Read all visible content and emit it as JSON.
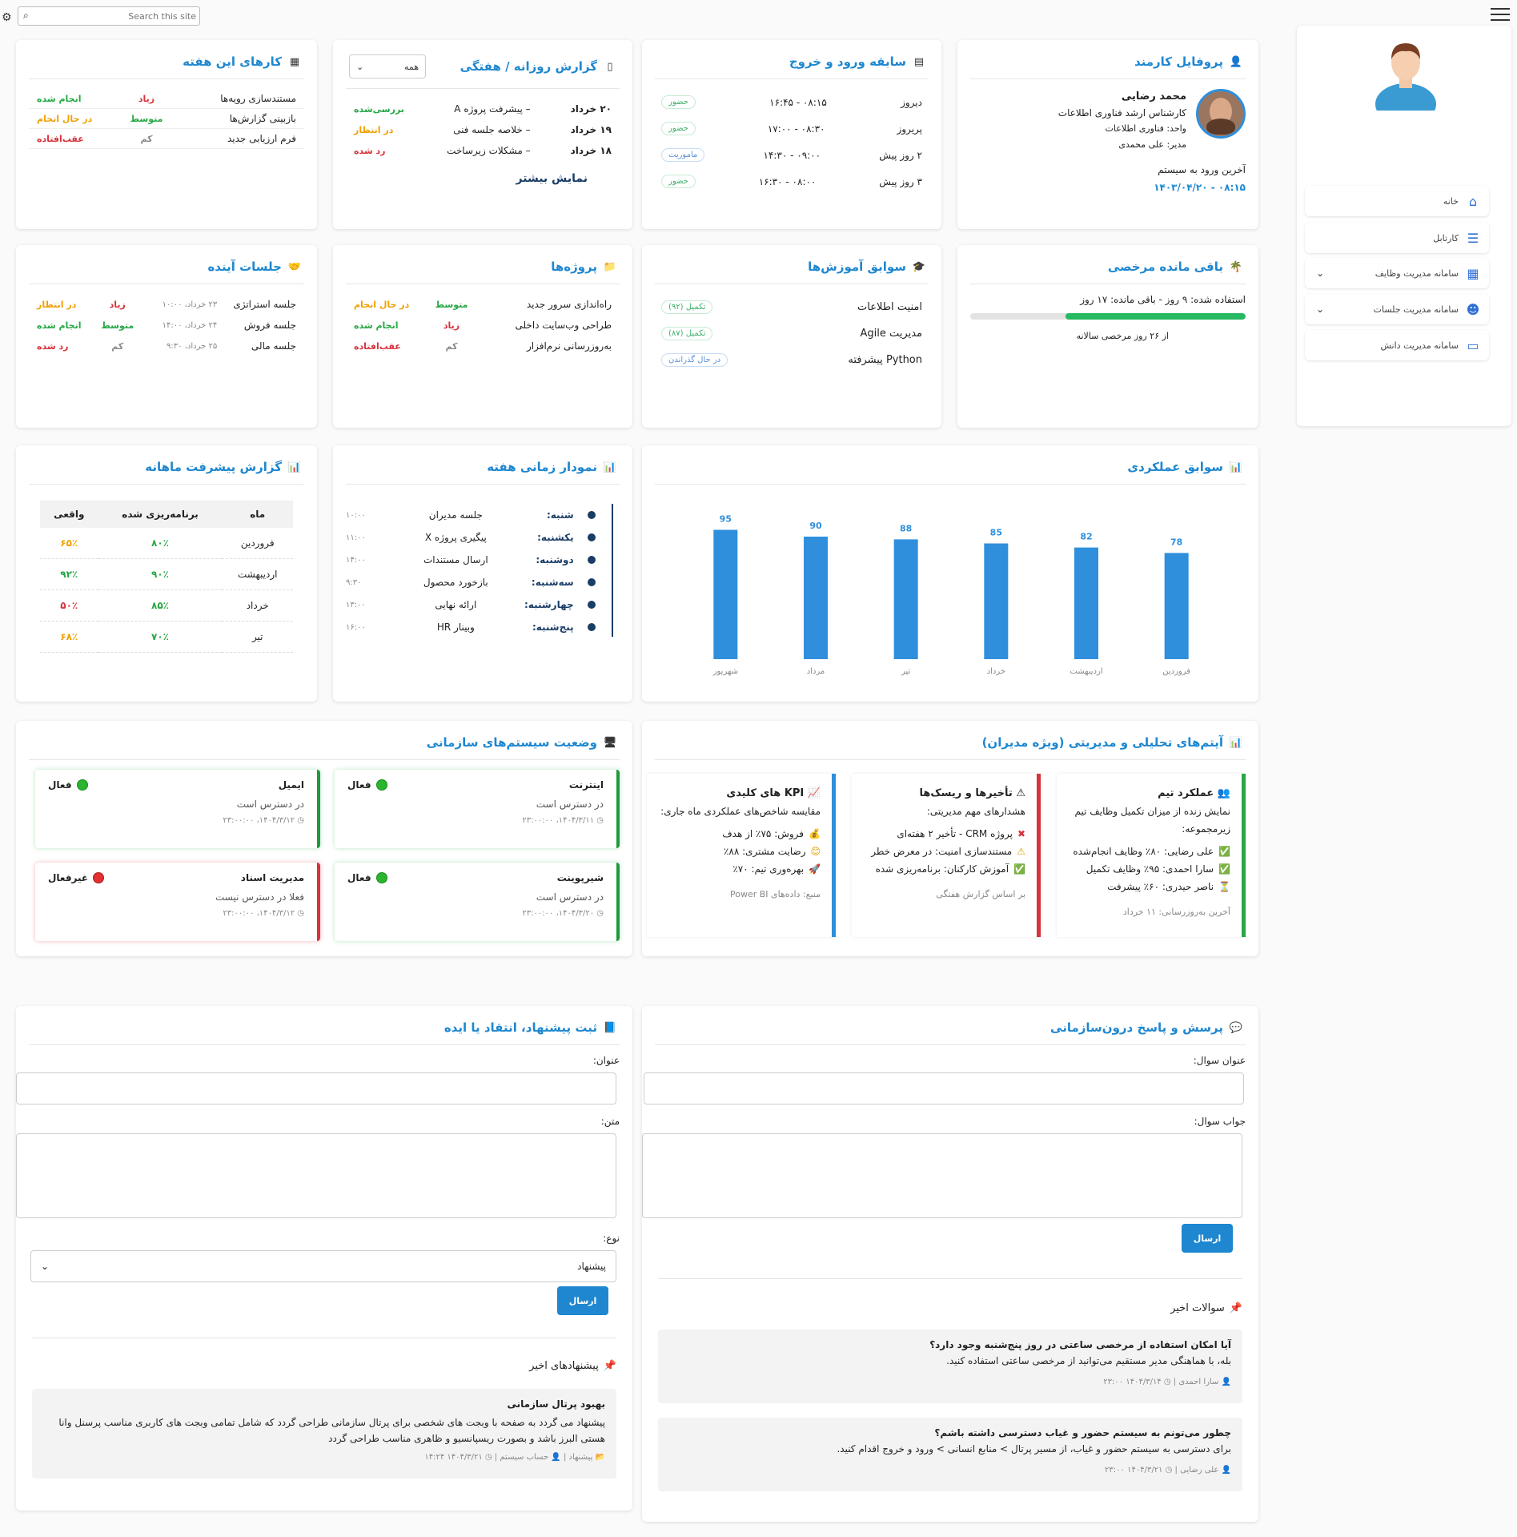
{
  "topbar": {
    "search_placeholder": "Search this site"
  },
  "sidebar": {
    "items": [
      {
        "label": "خانه",
        "icon": "home-icon"
      },
      {
        "label": "کارتابل",
        "icon": "inbox-icon"
      },
      {
        "label": "سامانه مدیریت وظایف",
        "icon": "tasks-icon"
      },
      {
        "label": "سامانه مدیریت جلسات",
        "icon": "users-icon"
      },
      {
        "label": "سامانه مدیریت دانش",
        "icon": "knowledge-icon"
      }
    ]
  },
  "profile": {
    "title": "پروفایل کارمند",
    "name": "محمد رضایی",
    "role": "کارشناس ارشد فناوری اطلاعات",
    "unit": "واحد: فناوری اطلاعات",
    "manager": "مدیر: علی محمدی",
    "last_login_label": "آخرین ورود به سیستم",
    "last_login_value": "۰۸:۱۵ - ۱۴۰۳/۰۴/۲۰"
  },
  "attendance": {
    "title": "سابقه ورود و خروج",
    "rows": [
      {
        "day": "دیروز",
        "time": "۰۸:۱۵ - ۱۶:۴۵",
        "status": "حضور",
        "kind": "green"
      },
      {
        "day": "پریروز",
        "time": "۰۸:۳۰ - ۱۷:۰۰",
        "status": "حضور",
        "kind": "green"
      },
      {
        "day": "۲ روز پیش",
        "time": "۰۹:۰۰ - ۱۴:۳۰",
        "status": "ماموریت",
        "kind": "blue"
      },
      {
        "day": "۳ روز پیش",
        "time": "۰۸:۰۰ - ۱۶:۳۰",
        "status": "حضور",
        "kind": "green"
      }
    ]
  },
  "daily_report": {
    "title": "گزارش روزانه / هفتگی",
    "filter": "همه",
    "rows": [
      {
        "date": "۲۰ خرداد",
        "text": "– پیشرفت پروژه A",
        "status": "بررسی‌شده",
        "kind": "green"
      },
      {
        "date": "۱۹ خرداد",
        "text": "– خلاصه جلسه فنی",
        "status": "در انتظار",
        "kind": "orange"
      },
      {
        "date": "۱۸ خرداد",
        "text": "– مشکلات زیرساخت",
        "status": "رد شده",
        "kind": "red"
      }
    ],
    "more": "نمایش بیشتر"
  },
  "week_tasks": {
    "title": "کارهای این هفته",
    "rows": [
      {
        "task": "مستندسازی رویه‌ها",
        "priority": "زیاد",
        "pkind": "red",
        "status": "انجام شده",
        "skind": "green"
      },
      {
        "task": "بازبینی گزارش‌ها",
        "priority": "متوسط",
        "pkind": "green",
        "status": "در حال انجام",
        "skind": "orange"
      },
      {
        "task": "فرم ارزیابی جدید",
        "priority": "کم",
        "pkind": "muted",
        "status": "عقب‌افتاده",
        "skind": "red"
      }
    ]
  },
  "leave": {
    "title": "باقی مانده مرخصی",
    "text": "استفاده شده: ۹ روز - باقی مانده: ۱۷ روز",
    "used_fraction": 0.654,
    "annual": "از ۲۶ روز مرخصی سالانه"
  },
  "training": {
    "title": "سوابق آموزش‌ها",
    "rows": [
      {
        "course": "امنیت اطلاعات",
        "status": "تکمیل (۹۲)",
        "kind": "green"
      },
      {
        "course": "مدیریت Agile",
        "status": "تکمیل (۸۷)",
        "kind": "green"
      },
      {
        "course": "Python پیشرفته",
        "status": "در حال گذراندن",
        "kind": "blue"
      }
    ]
  },
  "projects": {
    "title": "پروژه‌ها",
    "rows": [
      {
        "name": "راه‌اندازی سرور جدید",
        "priority": "متوسط",
        "pkind": "green",
        "status": "در حال انجام",
        "skind": "orange"
      },
      {
        "name": "طراحی وب‌سایت داخلی",
        "priority": "زیاد",
        "pkind": "red",
        "status": "انجام شده",
        "skind": "green"
      },
      {
        "name": "به‌روزرسانی نرم‌افزار",
        "priority": "کم",
        "pkind": "muted",
        "status": "عقب‌افتاده",
        "skind": "red"
      }
    ]
  },
  "meetings": {
    "title": "جلسات آینده",
    "rows": [
      {
        "name": "جلسه استراتژی",
        "when": "۲۳ خرداد، ۱۰:۰۰",
        "priority": "زیاد",
        "pkind": "red",
        "status": "در انتظار",
        "skind": "orange"
      },
      {
        "name": "جلسه فروش",
        "when": "۲۴ خرداد، ۱۴:۰۰",
        "priority": "متوسط",
        "pkind": "green",
        "status": "انجام شده",
        "skind": "green"
      },
      {
        "name": "جلسه مالی",
        "when": "۲۵ خرداد، ۹:۳۰",
        "priority": "کم",
        "pkind": "muted",
        "status": "رد شده",
        "skind": "red"
      }
    ]
  },
  "performance": {
    "title": "سوابق عملکردی"
  },
  "chart_data": {
    "type": "bar",
    "categories": [
      "فروردین",
      "اردیبهشت",
      "خرداد",
      "تیر",
      "مرداد",
      "شهریور"
    ],
    "values": [
      78,
      82,
      85,
      88,
      90,
      95
    ],
    "title": "",
    "xlabel": "",
    "ylabel": "",
    "color": "#2f8fdd",
    "ylim": [
      0,
      100
    ]
  },
  "timeline": {
    "title": "نمودار زمانی هفته",
    "rows": [
      {
        "day": "شنبه:",
        "event": "جلسه مدیران",
        "time": "۱۰:۰۰"
      },
      {
        "day": "یکشنبه:",
        "event": "پیگیری پروژه X",
        "time": "۱۱:۰۰"
      },
      {
        "day": "دوشنبه:",
        "event": "ارسال مستندات",
        "time": "۱۴:۰۰"
      },
      {
        "day": "سه‌شنبه:",
        "event": "بازخورد محصول",
        "time": "۹:۳۰"
      },
      {
        "day": "چهارشنبه:",
        "event": "ارائه نهایی",
        "time": "۱۳:۰۰"
      },
      {
        "day": "پنج‌شنبه:",
        "event": "وبینار HR",
        "time": "۱۶:۰۰"
      }
    ]
  },
  "monthly": {
    "title": "گزارش پیشرفت ماهانه",
    "headers": [
      "ماه",
      "برنامه‌ریزی شده",
      "واقعی"
    ],
    "rows": [
      {
        "month": "فروردین",
        "plan": "۸۰٪",
        "actual": "۶۵٪",
        "akind": "orange"
      },
      {
        "month": "اردیبهشت",
        "plan": "۹۰٪",
        "actual": "۹۲٪",
        "akind": "green"
      },
      {
        "month": "خرداد",
        "plan": "۸۵٪",
        "actual": "۵۰٪",
        "akind": "red"
      },
      {
        "month": "تیر",
        "plan": "۷۰٪",
        "actual": "۶۸٪",
        "akind": "orange"
      }
    ]
  },
  "analytics": {
    "title": "آیتم‌های تحلیلی و مدیریتی (ویژه مدیران)",
    "team": {
      "title": "عملکرد تیم",
      "desc": "نمایش زنده از میزان تکمیل وظایف تیم زیرمجموعه:",
      "items": [
        "علی رضایی: ۸۰٪ وظایف انجام‌شده",
        "سارا احمدی: ۹۵٪ وظایف تکمیل",
        "ناصر حیدری: ۶۰٪ پیشرفت"
      ],
      "footer": "آخرین به‌روزرسانی: ۱۱ خرداد"
    },
    "risks": {
      "title": "تأخیرها و ریسک‌ها",
      "desc": "هشدارهای مهم مدیریتی:",
      "items": [
        "پروژه CRM - تأخیر ۲ هفته‌ای",
        "مستندسازی امنیت: در معرض خطر",
        "آموزش کارکنان: برنامه‌ریزی شده"
      ],
      "footer": "بر اساس گزارش هفتگی"
    },
    "kpi": {
      "title": "KPI های کلیدی",
      "desc": "مقایسه شاخص‌های عملکردی ماه جاری:",
      "items": [
        "فروش: ۷۵٪ از هدف",
        "رضایت مشتری: ۸۸٪",
        "بهره‌وری تیم: ۷۰٪"
      ],
      "footer": "منبع: داده‌های Power BI"
    }
  },
  "systems": {
    "title": "وضعیت سیستم‌های سازمانی",
    "items": [
      {
        "name": "اینترنت",
        "state": "فعال",
        "ok": true,
        "desc": "در دسترس است",
        "time": "۱۴۰۴/۳/۱۱، ۲۳:۰۰:۰۰"
      },
      {
        "name": "ایمیل",
        "state": "فعال",
        "ok": true,
        "desc": "در دسترس است",
        "time": "۱۴۰۴/۳/۱۲، ۲۳:۰۰:۰۰"
      },
      {
        "name": "شیرپوینت",
        "state": "فعال",
        "ok": true,
        "desc": "در دسترس است",
        "time": "۱۴۰۴/۳/۲۰، ۲۳:۰۰:۰۰"
      },
      {
        "name": "مدیریت اسناد",
        "state": "غیرفعال",
        "ok": false,
        "desc": "فعلا در دسترس نیست",
        "time": "۱۴۰۴/۳/۱۲، ۲۳:۰۰:۰۰"
      }
    ]
  },
  "qa": {
    "title": "پرسش و پاسخ درون‌سازمانی",
    "q_label": "عنوان سوال:",
    "a_label": "جواب سوال:",
    "send": "ارسال",
    "recent_title": "سوالات اخیر",
    "recent": [
      {
        "q": "آیا امکان استفاده از مرخصی ساعتی در روز پنج‌شنبه وجود دارد؟",
        "a": "بله، با هماهنگی مدیر مستقیم می‌توانید از مرخصی ساعتی استفاده کنید.",
        "author": "سارا احمدی",
        "time": "۱۴۰۴/۳/۱۴ ۲۳:۰۰"
      },
      {
        "q": "چطور می‌تونم به سیستم حضور و غیاب دسترسی داشته باشم؟",
        "a": "برای دسترسی به سیستم حضور و غیاب، از مسیر پرتال > منابع انسانی > ورود و خروج اقدام کنید.",
        "author": "علی رضایی",
        "time": "۱۴۰۴/۳/۲۱ ۲۳:۰۰"
      }
    ]
  },
  "suggest": {
    "title": "ثبت پیشنهاد، انتقاد یا ایده",
    "title_label": "عنوان:",
    "text_label": "متن:",
    "type_label": "نوع:",
    "type_value": "پیشنهاد",
    "send": "ارسال",
    "recent_title": "پیشنهادهای اخیر",
    "recent": [
      {
        "title": "بهبود پرتال سازمانی",
        "text": "پیشنهاد می گردد به صفحه با وبجت های شخصی برای پرتال سازمانی طراحی گردد که شامل تمامی وبجت های کاربری مناسب پرسنل وانا هستی البرز باشد و بصورت ریسپانسیو و ظاهری مناسب طراحی گردد",
        "kind": "پیشنهاد",
        "author": "حساب سیستم",
        "time": "۱۴۰۴/۳/۲۱ ۱۴:۲۴"
      }
    ]
  }
}
